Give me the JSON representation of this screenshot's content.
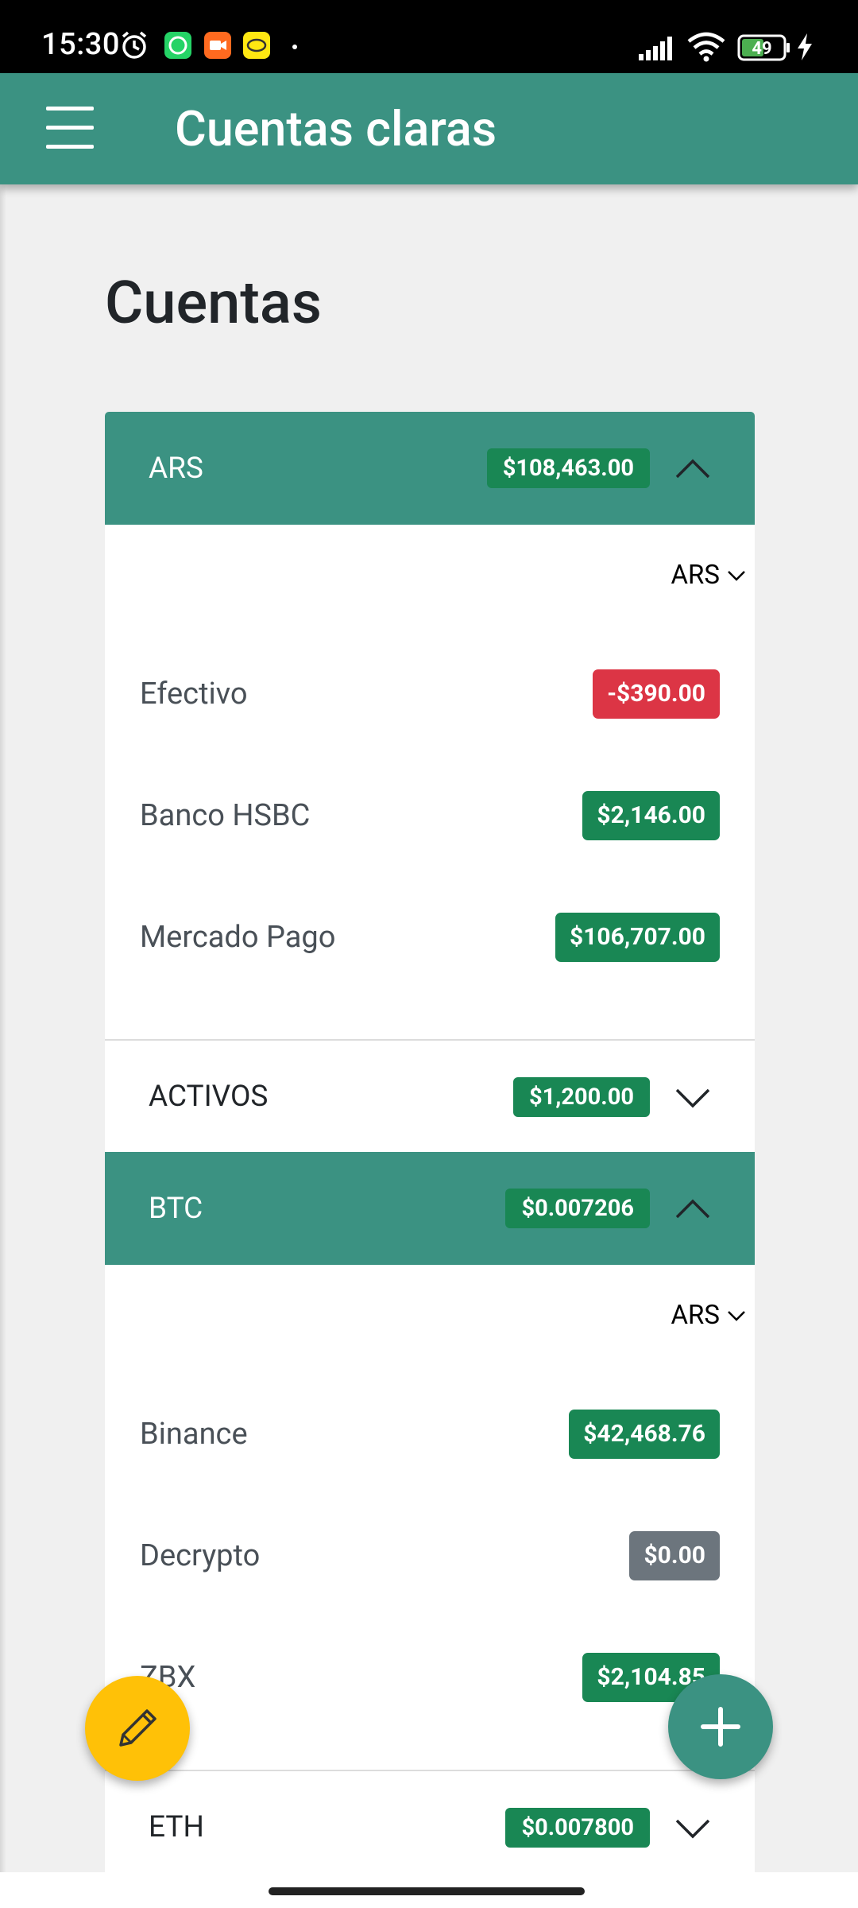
{
  "status_bar": {
    "time": "15:30",
    "battery": "49",
    "icons": [
      "alarm-icon",
      "whatsapp-icon",
      "video-call-icon",
      "app-icon",
      "signal-icon",
      "wifi-icon",
      "battery-icon",
      "charging-icon"
    ]
  },
  "app_bar": {
    "title": "Cuentas claras",
    "menu_icon": "hamburger-menu-icon"
  },
  "page": {
    "title": "Cuentas"
  },
  "accordion": {
    "ars": {
      "label": "ARS",
      "total": "$108,463.00",
      "currency": "ARS",
      "accounts": [
        {
          "name": "Efectivo",
          "amount": "-$390.00",
          "status": "negative"
        },
        {
          "name": "Banco HSBC",
          "amount": "$2,146.00",
          "status": "positive"
        },
        {
          "name": "Mercado Pago",
          "amount": "$106,707.00",
          "status": "positive"
        }
      ]
    },
    "activos": {
      "label": "ACTIVOS",
      "total": "$1,200.00"
    },
    "btc": {
      "label": "BTC",
      "total": "$0.007206",
      "currency": "ARS",
      "accounts": [
        {
          "name": "Binance",
          "amount": "$42,468.76",
          "status": "positive"
        },
        {
          "name": "Decrypto",
          "amount": "$0.00",
          "status": "zero"
        },
        {
          "name": "ZBX",
          "amount": "$2,104.85",
          "status": "positive"
        }
      ]
    },
    "eth": {
      "label": "ETH",
      "total": "$0.007800"
    }
  },
  "fabs": {
    "edit_icon": "pencil-icon",
    "add_icon": "plus-icon"
  },
  "colors": {
    "primary": "#3b9282",
    "positive": "#198754",
    "negative": "#dc3545",
    "zero": "#6c757d",
    "edit_fab": "#ffc107"
  }
}
